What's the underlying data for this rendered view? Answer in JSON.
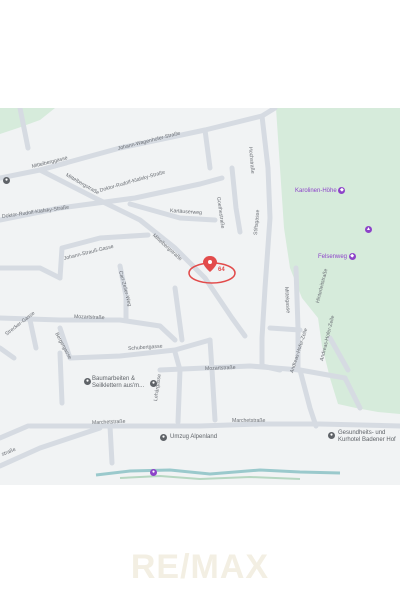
{
  "streets": {
    "johann_wagenhofer": "Johann-Wagenhofer-Straße",
    "mittelberggasse_top": "Mittelberggasse",
    "mittelbergstrasse_left": "Mittelbergstraße",
    "doktor_rudolf_klafsky_upper": "Doktor-Rudolf-Klafsky-Straße",
    "doktor_rudolf_klafsky_lower": "Doktor-Rudolf-Klafsky-Straße",
    "kartauserweg": "Kartäuserweg",
    "johann_strauss": "Johann-Strauß-Gasse",
    "mittelbergstrasse_diag": "Mittelbergstraße",
    "carl_zeller": "Carl-Zeller-Weg",
    "mozartstrasse_upper": "Mozartstraße",
    "strecker": "Strecker-Gasse",
    "bergergasse": "Bergergasse",
    "schubertgasse": "Schubertgasse",
    "mozartstrasse_lower": "Mozartstraße",
    "lehargasse": "Lehárgasse",
    "marchetstrasse_left": "Marchetstraße",
    "marchetstrasse_right": "Marchetstraße",
    "goethestrasse": "Goethestraße",
    "hochstrasse": "Hochstraße",
    "stiftsgasse": "Stiftsgasse",
    "hinterleitstrasse": "Hinterleitstraße",
    "andreas_hofer_1": "Andreas-Hofer-Zeile",
    "andreas_hofer_2": "Andreas-Hofer-Zeile",
    "mittelgasse": "Mittelgasse",
    "strasse_bottom_left": "straße"
  },
  "pois": {
    "karolinen": "Karolinen-Höhe",
    "felsenweg": "Felsenweg",
    "baumarbeiten_line1": "Baumarbeiten &",
    "baumarbeiten_line2": "Seilklettern aus'm...",
    "umzug": "Umzug Alpenland",
    "gesundheits_line1": "Gesundheits- und",
    "gesundheits_line2": "Kurhotel Badener Hof"
  },
  "marker": {
    "number": "64"
  },
  "watermark": {
    "text": "RE/MAX"
  },
  "colors": {
    "road": "#d6dbe2",
    "park": "#d6ebdb",
    "marker": "#e24b4b",
    "poi_purple": "#8d43c9",
    "water": "#9ac9cc"
  }
}
